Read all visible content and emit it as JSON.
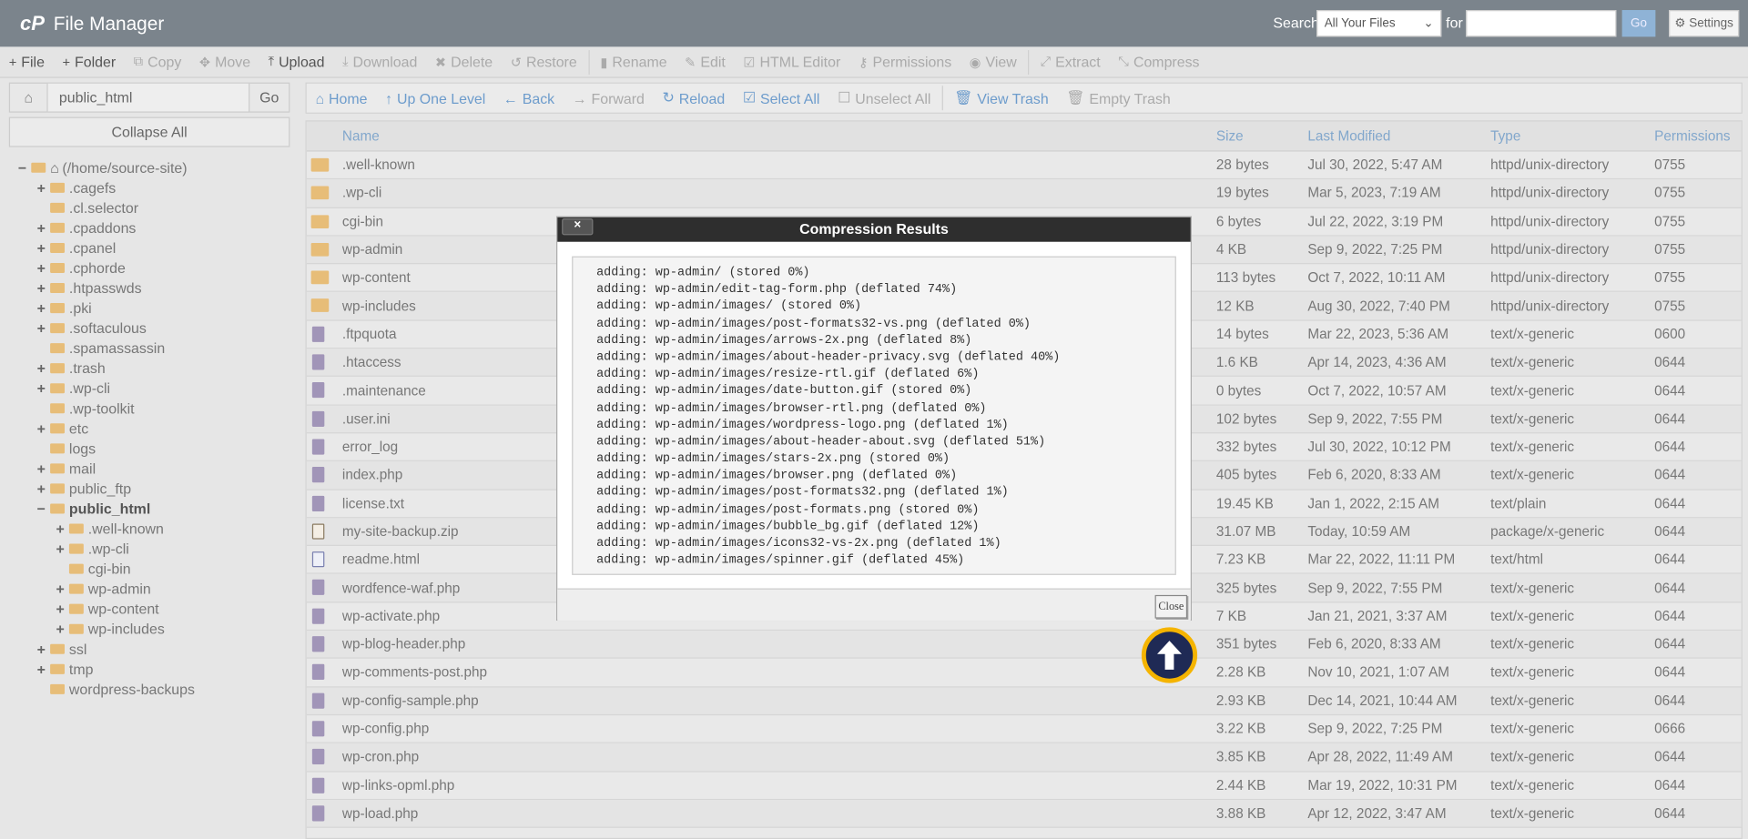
{
  "header": {
    "logo": "cP",
    "title": "File Manager",
    "search_label": "Search",
    "search_scope": "All Your Files",
    "for_label": "for",
    "search_value": "",
    "go": "Go",
    "settings": "Settings"
  },
  "toolbar": [
    {
      "label": "File",
      "icon": "plus-icon",
      "glyph": "+",
      "enabled": true
    },
    {
      "label": "Folder",
      "icon": "plus-icon",
      "glyph": "+",
      "enabled": true
    },
    {
      "label": "Copy",
      "icon": "copy-icon",
      "glyph": "⧉",
      "enabled": false
    },
    {
      "label": "Move",
      "icon": "move-icon",
      "glyph": "✥",
      "enabled": false
    },
    {
      "label": "Upload",
      "icon": "upload-icon",
      "glyph": "⤒",
      "enabled": true
    },
    {
      "label": "Download",
      "icon": "download-icon",
      "glyph": "⤓",
      "enabled": false
    },
    {
      "label": "Delete",
      "icon": "delete-icon",
      "glyph": "✖",
      "enabled": false
    },
    {
      "label": "Restore",
      "icon": "restore-icon",
      "glyph": "↺",
      "enabled": false,
      "sep": true
    },
    {
      "label": "Rename",
      "icon": "rename-icon",
      "glyph": "▮",
      "enabled": false
    },
    {
      "label": "Edit",
      "icon": "pencil-icon",
      "glyph": "✎",
      "enabled": false
    },
    {
      "label": "HTML Editor",
      "icon": "html-editor-icon",
      "glyph": "☑",
      "enabled": false
    },
    {
      "label": "Permissions",
      "icon": "key-icon",
      "glyph": "⚷",
      "enabled": false
    },
    {
      "label": "View",
      "icon": "eye-icon",
      "glyph": "◉",
      "enabled": false,
      "sep": true
    },
    {
      "label": "Extract",
      "icon": "extract-icon",
      "glyph": "⤢",
      "enabled": false
    },
    {
      "label": "Compress",
      "icon": "compress-icon",
      "glyph": "⤡",
      "enabled": false
    }
  ],
  "path": {
    "value": "public_html",
    "go": "Go"
  },
  "collapse_all": "Collapse All",
  "tree": [
    {
      "label": "(/home/source-site)",
      "level": 0,
      "toggle": "−",
      "open": true,
      "home": true
    },
    {
      "label": ".cagefs",
      "level": 1,
      "toggle": "+"
    },
    {
      "label": ".cl.selector",
      "level": 1,
      "toggle": ""
    },
    {
      "label": ".cpaddons",
      "level": 1,
      "toggle": "+"
    },
    {
      "label": ".cpanel",
      "level": 1,
      "toggle": "+"
    },
    {
      "label": ".cphorde",
      "level": 1,
      "toggle": "+"
    },
    {
      "label": ".htpasswds",
      "level": 1,
      "toggle": "+"
    },
    {
      "label": ".pki",
      "level": 1,
      "toggle": "+"
    },
    {
      "label": ".softaculous",
      "level": 1,
      "toggle": "+"
    },
    {
      "label": ".spamassassin",
      "level": 1,
      "toggle": ""
    },
    {
      "label": ".trash",
      "level": 1,
      "toggle": "+"
    },
    {
      "label": ".wp-cli",
      "level": 1,
      "toggle": "+"
    },
    {
      "label": ".wp-toolkit",
      "level": 1,
      "toggle": ""
    },
    {
      "label": "etc",
      "level": 1,
      "toggle": "+"
    },
    {
      "label": "logs",
      "level": 1,
      "toggle": ""
    },
    {
      "label": "mail",
      "level": 1,
      "toggle": "+"
    },
    {
      "label": "public_ftp",
      "level": 1,
      "toggle": "+"
    },
    {
      "label": "public_html",
      "level": 1,
      "toggle": "−",
      "open": true,
      "selected": true
    },
    {
      "label": ".well-known",
      "level": 2,
      "toggle": "+"
    },
    {
      "label": ".wp-cli",
      "level": 2,
      "toggle": "+"
    },
    {
      "label": "cgi-bin",
      "level": 2,
      "toggle": ""
    },
    {
      "label": "wp-admin",
      "level": 2,
      "toggle": "+"
    },
    {
      "label": "wp-content",
      "level": 2,
      "toggle": "+"
    },
    {
      "label": "wp-includes",
      "level": 2,
      "toggle": "+"
    },
    {
      "label": "ssl",
      "level": 1,
      "toggle": "+"
    },
    {
      "label": "tmp",
      "level": 1,
      "toggle": "+"
    },
    {
      "label": "wordpress-backups",
      "level": 1,
      "toggle": ""
    }
  ],
  "nav": [
    {
      "label": "Home",
      "icon": "home-icon",
      "glyph": "⌂",
      "enabled": true
    },
    {
      "label": "Up One Level",
      "icon": "up-arrow-icon",
      "glyph": "↑",
      "enabled": true
    },
    {
      "label": "Back",
      "icon": "back-arrow-icon",
      "glyph": "←",
      "enabled": true
    },
    {
      "label": "Forward",
      "icon": "forward-arrow-icon",
      "glyph": "→",
      "enabled": false
    },
    {
      "label": "Reload",
      "icon": "reload-icon",
      "glyph": "↻",
      "enabled": true
    },
    {
      "label": "Select All",
      "icon": "checkbox-checked-icon",
      "glyph": "☑",
      "enabled": true
    },
    {
      "label": "Unselect All",
      "icon": "checkbox-empty-icon",
      "glyph": "☐",
      "enabled": false,
      "sep": true
    },
    {
      "label": "View Trash",
      "icon": "trash-icon",
      "glyph": "🗑",
      "enabled": true
    },
    {
      "label": "Empty Trash",
      "icon": "trash-icon",
      "glyph": "🗑",
      "enabled": false
    }
  ],
  "columns": [
    "Name",
    "Size",
    "Last Modified",
    "Type",
    "Permissions"
  ],
  "files": [
    {
      "name": ".well-known",
      "size": "28 bytes",
      "modified": "Jul 30, 2022, 5:47 AM",
      "type": "httpd/unix-directory",
      "perms": "0755",
      "kind": "dir"
    },
    {
      "name": ".wp-cli",
      "size": "19 bytes",
      "modified": "Mar 5, 2023, 7:19 AM",
      "type": "httpd/unix-directory",
      "perms": "0755",
      "kind": "dir"
    },
    {
      "name": "cgi-bin",
      "size": "6 bytes",
      "modified": "Jul 22, 2022, 3:19 PM",
      "type": "httpd/unix-directory",
      "perms": "0755",
      "kind": "dir"
    },
    {
      "name": "wp-admin",
      "size": "4 KB",
      "modified": "Sep 9, 2022, 7:25 PM",
      "type": "httpd/unix-directory",
      "perms": "0755",
      "kind": "dir"
    },
    {
      "name": "wp-content",
      "size": "113 bytes",
      "modified": "Oct 7, 2022, 10:11 AM",
      "type": "httpd/unix-directory",
      "perms": "0755",
      "kind": "dir"
    },
    {
      "name": "wp-includes",
      "size": "12 KB",
      "modified": "Aug 30, 2022, 7:40 PM",
      "type": "httpd/unix-directory",
      "perms": "0755",
      "kind": "dir"
    },
    {
      "name": ".ftpquota",
      "size": "14 bytes",
      "modified": "Mar 22, 2023, 5:36 AM",
      "type": "text/x-generic",
      "perms": "0600",
      "kind": "file"
    },
    {
      "name": ".htaccess",
      "size": "1.6 KB",
      "modified": "Apr 14, 2023, 4:36 AM",
      "type": "text/x-generic",
      "perms": "0644",
      "kind": "file"
    },
    {
      "name": ".maintenance",
      "size": "0 bytes",
      "modified": "Oct 7, 2022, 10:57 AM",
      "type": "text/x-generic",
      "perms": "0644",
      "kind": "file"
    },
    {
      "name": ".user.ini",
      "size": "102 bytes",
      "modified": "Sep 9, 2022, 7:55 PM",
      "type": "text/x-generic",
      "perms": "0644",
      "kind": "file"
    },
    {
      "name": "error_log",
      "size": "332 bytes",
      "modified": "Jul 30, 2022, 10:12 PM",
      "type": "text/x-generic",
      "perms": "0644",
      "kind": "file"
    },
    {
      "name": "index.php",
      "size": "405 bytes",
      "modified": "Feb 6, 2020, 8:33 AM",
      "type": "text/x-generic",
      "perms": "0644",
      "kind": "file"
    },
    {
      "name": "license.txt",
      "size": "19.45 KB",
      "modified": "Jan 1, 2022, 2:15 AM",
      "type": "text/plain",
      "perms": "0644",
      "kind": "file"
    },
    {
      "name": "my-site-backup.zip",
      "size": "31.07 MB",
      "modified": "Today, 10:59 AM",
      "type": "package/x-generic",
      "perms": "0644",
      "kind": "zip"
    },
    {
      "name": "readme.html",
      "size": "7.23 KB",
      "modified": "Mar 22, 2022, 11:11 PM",
      "type": "text/html",
      "perms": "0644",
      "kind": "html"
    },
    {
      "name": "wordfence-waf.php",
      "size": "325 bytes",
      "modified": "Sep 9, 2022, 7:55 PM",
      "type": "text/x-generic",
      "perms": "0644",
      "kind": "file"
    },
    {
      "name": "wp-activate.php",
      "size": "7 KB",
      "modified": "Jan 21, 2021, 3:37 AM",
      "type": "text/x-generic",
      "perms": "0644",
      "kind": "file"
    },
    {
      "name": "wp-blog-header.php",
      "size": "351 bytes",
      "modified": "Feb 6, 2020, 8:33 AM",
      "type": "text/x-generic",
      "perms": "0644",
      "kind": "file"
    },
    {
      "name": "wp-comments-post.php",
      "size": "2.28 KB",
      "modified": "Nov 10, 2021, 1:07 AM",
      "type": "text/x-generic",
      "perms": "0644",
      "kind": "file"
    },
    {
      "name": "wp-config-sample.php",
      "size": "2.93 KB",
      "modified": "Dec 14, 2021, 10:44 AM",
      "type": "text/x-generic",
      "perms": "0644",
      "kind": "file"
    },
    {
      "name": "wp-config.php",
      "size": "3.22 KB",
      "modified": "Sep 9, 2022, 7:25 PM",
      "type": "text/x-generic",
      "perms": "0666",
      "kind": "file"
    },
    {
      "name": "wp-cron.php",
      "size": "3.85 KB",
      "modified": "Apr 28, 2022, 11:49 AM",
      "type": "text/x-generic",
      "perms": "0644",
      "kind": "file"
    },
    {
      "name": "wp-links-opml.php",
      "size": "2.44 KB",
      "modified": "Mar 19, 2022, 10:31 PM",
      "type": "text/x-generic",
      "perms": "0644",
      "kind": "file"
    },
    {
      "name": "wp-load.php",
      "size": "3.88 KB",
      "modified": "Apr 12, 2022, 3:47 AM",
      "type": "text/x-generic",
      "perms": "0644",
      "kind": "file"
    }
  ],
  "dialog": {
    "title": "Compression Results",
    "close_x": "×",
    "close": "Close",
    "lines": [
      "adding: wp-admin/ (stored 0%)",
      "adding: wp-admin/edit-tag-form.php (deflated 74%)",
      "adding: wp-admin/images/ (stored 0%)",
      "adding: wp-admin/images/post-formats32-vs.png (deflated 0%)",
      "adding: wp-admin/images/arrows-2x.png (deflated 8%)",
      "adding: wp-admin/images/about-header-privacy.svg (deflated 40%)",
      "adding: wp-admin/images/resize-rtl.gif (deflated 6%)",
      "adding: wp-admin/images/date-button.gif (stored 0%)",
      "adding: wp-admin/images/browser-rtl.png (deflated 0%)",
      "adding: wp-admin/images/wordpress-logo.png (deflated 1%)",
      "adding: wp-admin/images/about-header-about.svg (deflated 51%)",
      "adding: wp-admin/images/stars-2x.png (stored 0%)",
      "adding: wp-admin/images/browser.png (deflated 0%)",
      "adding: wp-admin/images/post-formats32.png (deflated 1%)",
      "adding: wp-admin/images/post-formats.png (stored 0%)",
      "adding: wp-admin/images/bubble_bg.gif (deflated 12%)",
      "adding: wp-admin/images/icons32-vs-2x.png (deflated 1%)",
      "adding: wp-admin/images/spinner.gif (deflated 45%)"
    ]
  },
  "colors": {
    "topbar": "#7b848c",
    "accent": "#6d9ccc",
    "folder": "#e7bd78",
    "file": "#a195b8",
    "upload_ring": "#f5b400",
    "upload_fill": "#1f2a55"
  }
}
